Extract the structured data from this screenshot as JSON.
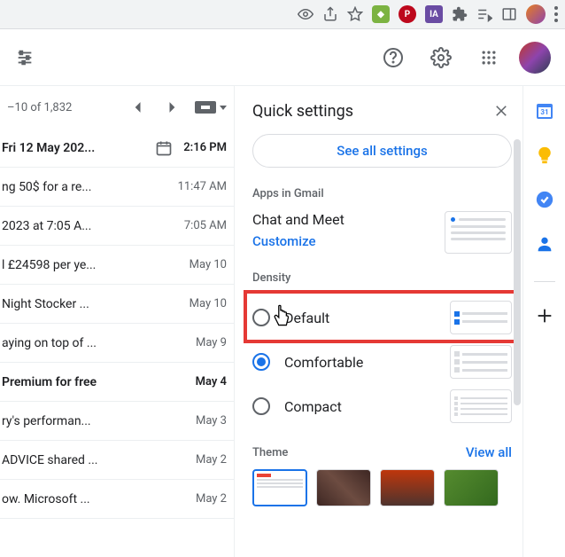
{
  "pager": {
    "count_text": "–10 of 1,832"
  },
  "emails": [
    {
      "subject": "Fri 12 May 202...",
      "date": "2:16 PM",
      "bold": true,
      "has_picker": true
    },
    {
      "subject": "ng 50$ for a re...",
      "date": "11:47 AM",
      "bold": false
    },
    {
      "subject": " 2023 at 7:05 A...",
      "date": "7:05 AM",
      "bold": false
    },
    {
      "subject": "l £24598 per ye...",
      "date": "May 10",
      "bold": false
    },
    {
      "subject": " Night Stocker ...",
      "date": "May 10",
      "bold": false
    },
    {
      "subject": "aying on top of ...",
      "date": "May 9",
      "bold": false
    },
    {
      "subject": "Premium for free",
      "date": "May 4",
      "bold": true
    },
    {
      "subject": "ry's performan...",
      "date": "May 3",
      "bold": false
    },
    {
      "subject": "ADVICE shared ...",
      "date": "May 2",
      "bold": false
    },
    {
      "subject": "ow. Microsoft ...",
      "date": "May 2",
      "bold": false
    }
  ],
  "panel": {
    "title": "Quick settings",
    "see_all": "See all settings",
    "apps_label": "Apps in Gmail",
    "chat_title": "Chat and Meet",
    "customize": "Customize",
    "density_label": "Density",
    "density": {
      "default": "Default",
      "comfortable": "Comfortable",
      "compact": "Compact",
      "selected": "comfortable",
      "highlighted": "default"
    },
    "theme_label": "Theme",
    "view_all": "View all"
  }
}
